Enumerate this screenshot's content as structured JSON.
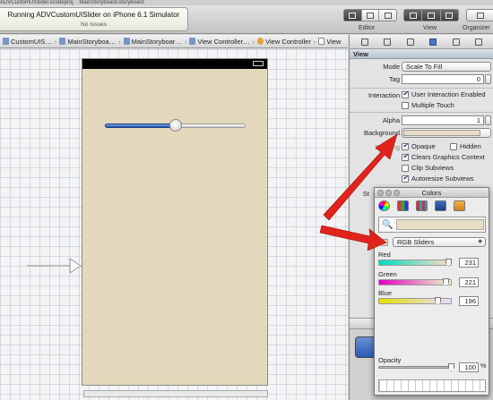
{
  "window": {
    "file_tabs": [
      "ADVCustomUISlider.xcodeproj",
      "MainStoryboard.storyboard"
    ]
  },
  "toolbar": {
    "activity_title": "Running ADVCustomUISlider on iPhone 6.1 Simulator",
    "activity_status": "No Issues",
    "editor_label": "Editor",
    "view_label": "View",
    "organizer_label": "Organizer"
  },
  "jump_bar": {
    "crumbs": [
      "CustomUIS…",
      "MainStoryboa…",
      "MainStoryboar…",
      "View Controller…",
      "View Controller",
      "View"
    ]
  },
  "inspector": {
    "section_title": "View",
    "mode_label": "Mode",
    "mode_value": "Scale To Fill",
    "tag_label": "Tag",
    "tag_value": "0",
    "interaction_label": "Interaction",
    "user_interaction": "User Interaction Enabled",
    "multiple_touch": "Multiple Touch",
    "alpha_label": "Alpha",
    "alpha_value": "1",
    "background_label": "Background",
    "drawing_label": "Drawing",
    "opaque": "Opaque",
    "hidden": "Hidden",
    "clears_context": "Clears Graphics Context",
    "clip_subviews": "Clip Subviews",
    "autoresize": "Autoresize Subviews",
    "stretching_label": "St"
  },
  "colors_panel": {
    "title": "Colors",
    "mode_value": "RGB Sliders",
    "red_label": "Red",
    "red_value": "231",
    "green_label": "Green",
    "green_value": "221",
    "blue_label": "Blue",
    "blue_value": "196",
    "opacity_label": "Opacity",
    "opacity_value": "100",
    "percent": "%",
    "swatch_color": "#e7ddc4"
  },
  "canvas": {
    "view_background": "#e4d8bc",
    "slider_value": 0.5
  },
  "colors": {
    "arrow": "#e0231c",
    "accent": "#1e4fa8"
  }
}
